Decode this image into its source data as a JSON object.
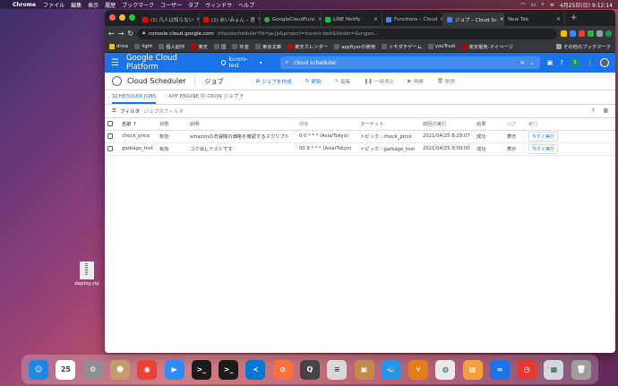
{
  "menubar": {
    "app": "Chrome",
    "items": [
      "ファイル",
      "編集",
      "表示",
      "履歴",
      "ブックマーク",
      "ユーザー",
      "タブ",
      "ウィンドウ",
      "ヘルプ"
    ],
    "clock": "4月25日(日) 9:12:14"
  },
  "browser": {
    "tabs": [
      {
        "title": "(1) 凡人は知らない",
        "color": "#ff0000"
      },
      {
        "title": "(1) あいみょん – 君",
        "color": "#ff0000"
      },
      {
        "title": "GoogleCloudFunc",
        "color": "#34a853"
      },
      {
        "title": "LINE Notify",
        "color": "#06c755"
      },
      {
        "title": "Functions – Cloud",
        "color": "#4285f4"
      },
      {
        "title": "ジョブ – Cloud Sc",
        "color": "#4285f4"
      },
      {
        "title": "New Tab",
        "color": "#9aa0a6"
      }
    ],
    "url_host": "console.cloud.google.com",
    "url_rest": "/cloudscheduler?hl=ja-jp&project=kuroro-test&folder=&organ...",
    "bookmarks": [
      {
        "label": "drive",
        "color": "#fbbc04"
      },
      {
        "label": "light",
        "color": "#5f6368"
      },
      {
        "label": "個人創作",
        "color": "#5f6368"
      },
      {
        "label": "楽天",
        "color": "#bf0000"
      },
      {
        "label": "国",
        "color": "#5f6368"
      },
      {
        "label": "年金",
        "color": "#5f6368"
      },
      {
        "label": "東京文庫",
        "color": "#5f6368"
      },
      {
        "label": "楽天カレンダー",
        "color": "#bf0000"
      },
      {
        "label": "appfiyerの使用",
        "color": "#5f6368"
      },
      {
        "label": "トモダチゲーム",
        "color": "#5f6368"
      },
      {
        "label": "youTrust",
        "color": "#5f6368"
      },
      {
        "label": "楽天電気-マイページ",
        "color": "#bf0000"
      }
    ],
    "other_bookmarks": "その他のブックマーク"
  },
  "gcp": {
    "brand": "Google Cloud Platform",
    "project": "kuroro-test",
    "search": "cloud scheduler",
    "avatar_letter": "1",
    "service_name": "Cloud Scheduler",
    "page_title": "ジョブ",
    "actions": {
      "create": "ジョブを作成",
      "refresh": "更新",
      "edit": "編集",
      "pause": "一時停止",
      "resume": "再開",
      "delete": "削除"
    },
    "content_tabs": [
      "SCHEDULER JOBS",
      "APP ENGINE の CRON ジョブ"
    ],
    "filter_label": "フィルタ",
    "filter_placeholder": "ジョブのフィルタ",
    "columns": [
      "名前",
      "状態",
      "説明",
      "頻度",
      "ターゲット",
      "前回の実行",
      "結果",
      "ログ",
      "実行"
    ],
    "jobs": [
      {
        "name": "check_price",
        "state": "有効",
        "description": "amazonの洗濯機の価格を確認するスクリプト",
        "frequency": "0 0 * * * (Asia/Tokyo)",
        "target": "トピック : check_price",
        "last_run": "2021/04/25 8:29:07",
        "result": "成功",
        "log": "表示",
        "run": "今すぐ実行"
      },
      {
        "name": "garbage_test",
        "state": "有効",
        "description": "ゴミ出しテストです",
        "frequency": "00 9 * * * (Asia/Tokyo)",
        "target": "トピック : garbage_test",
        "last_run": "2021/04/25 9:00:00",
        "result": "成功",
        "log": "表示",
        "run": "今すぐ実行"
      }
    ]
  },
  "desktop": {
    "file": "deploy.zip"
  },
  "dock": [
    {
      "name": "finder",
      "color": "#1e88e5",
      "glyph": "☺"
    },
    {
      "name": "calendar",
      "color": "#ffffff",
      "glyph": "25"
    },
    {
      "name": "system-preferences",
      "color": "#8e8e93",
      "glyph": "⚙"
    },
    {
      "name": "contacts",
      "color": "#c69c6d",
      "glyph": "☻"
    },
    {
      "name": "chrome",
      "color": "#ea4335",
      "glyph": "◉"
    },
    {
      "name": "zoom",
      "color": "#2d8cff",
      "glyph": "▶"
    },
    {
      "name": "terminal-1",
      "color": "#1b1b1b",
      "glyph": ">_"
    },
    {
      "name": "terminal-2",
      "color": "#1b1b1b",
      "glyph": ">_"
    },
    {
      "name": "vscode",
      "color": "#0078d4",
      "glyph": "≺"
    },
    {
      "name": "safari-alt",
      "color": "#ff6f3c",
      "glyph": "⊘"
    },
    {
      "name": "quicktime",
      "color": "#444",
      "glyph": "Q"
    },
    {
      "name": "sequel",
      "color": "#d9d9d9",
      "glyph": "≡"
    },
    {
      "name": "package",
      "color": "#c28a4b",
      "glyph": "▣"
    },
    {
      "name": "docker",
      "color": "#2496ed",
      "glyph": "🐳"
    },
    {
      "name": "sourcetree",
      "color": "#e37e1a",
      "glyph": "⑂"
    },
    {
      "name": "gcp-sdk",
      "color": "#e8eaed",
      "glyph": "◍"
    },
    {
      "name": "preview",
      "color": "#f1a03a",
      "glyph": "▤"
    },
    {
      "name": "infinity",
      "color": "#1a73e8",
      "glyph": "∞"
    },
    {
      "name": "alarm",
      "color": "#e53935",
      "glyph": "◷"
    },
    {
      "name": "photos",
      "color": "#cfd8dc",
      "glyph": "▦"
    },
    {
      "name": "trash",
      "color": "#9e9e9e",
      "glyph": "🗑"
    }
  ]
}
